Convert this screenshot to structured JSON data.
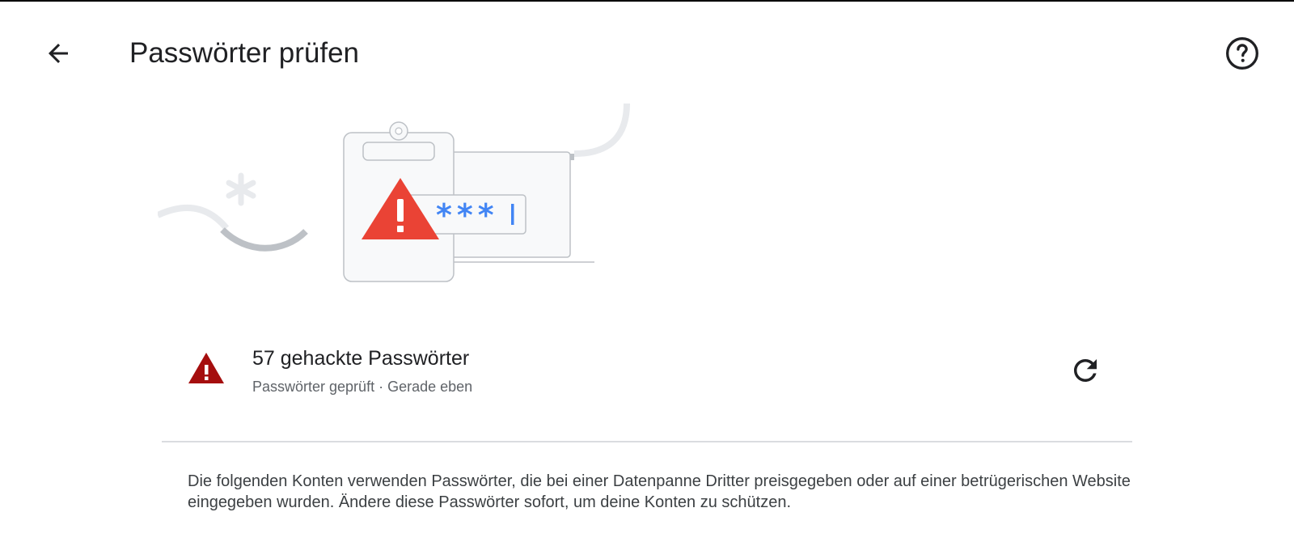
{
  "header": {
    "title": "Passwörter prüfen",
    "back_icon": "arrow-back-icon",
    "help_icon": "help-icon"
  },
  "illustration": {
    "masked_password": "***",
    "icons": [
      "clipboard-icon",
      "warning-triangle-icon",
      "asterisk-icon",
      "password-field"
    ]
  },
  "status": {
    "title": "57 gehackte Passwörter",
    "subtitle": "Passwörter geprüft · Gerade eben",
    "warning_icon": "warning-icon",
    "refresh_icon": "refresh-icon"
  },
  "description": "Die folgenden Konten verwenden Passwörter, die bei einer Datenpanne Dritter preisgegeben oder auf einer betrügerischen Website eingegeben wurden. Ändere diese Passwörter sofort, um deine Konten zu schützen.",
  "colors": {
    "warning_red": "#ea4335",
    "warning_dark_red": "#a50e0e",
    "password_blue": "#4285f4",
    "text_primary": "#202124",
    "text_secondary": "#5f6368",
    "divider": "#dadce0"
  }
}
